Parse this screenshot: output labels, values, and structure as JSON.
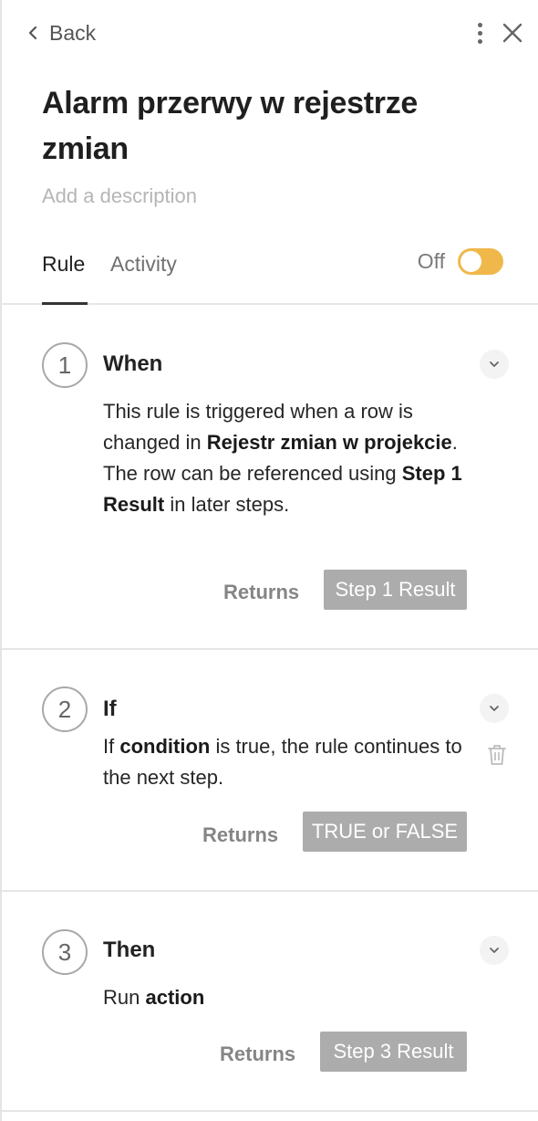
{
  "header": {
    "back_label": "Back",
    "title": "Alarm przerwy w rejestrze zmian",
    "description_placeholder": "Add a description"
  },
  "tabs": [
    {
      "label": "Rule",
      "active": true
    },
    {
      "label": "Activity",
      "active": false
    }
  ],
  "toggle": {
    "label": "Off",
    "state": "off",
    "color": "#f0b84a"
  },
  "steps": [
    {
      "number": "1",
      "title": "When",
      "text": {
        "p1": "This rule is triggered when a row is changed in ",
        "b1": "Rejestr zmian w projekcie",
        "p2": ". The row can be referenced using ",
        "b2": "Step 1 Result",
        "p3": " in later steps."
      },
      "returns_label": "Returns",
      "returns_value": "Step 1 Result"
    },
    {
      "number": "2",
      "title": "If",
      "text": {
        "p1": "If ",
        "b1": "condition",
        "p2": " is true, the rule continues to the next step."
      },
      "returns_label": "Returns",
      "returns_value": "TRUE or FALSE"
    },
    {
      "number": "3",
      "title": "Then",
      "text": {
        "p1": "Run ",
        "b1": "action"
      },
      "returns_label": "Returns",
      "returns_value": "Step 3 Result"
    }
  ],
  "icons": [
    "chevron-left-icon",
    "more-vertical-icon",
    "close-icon",
    "chevron-down-icon",
    "trash-icon"
  ]
}
